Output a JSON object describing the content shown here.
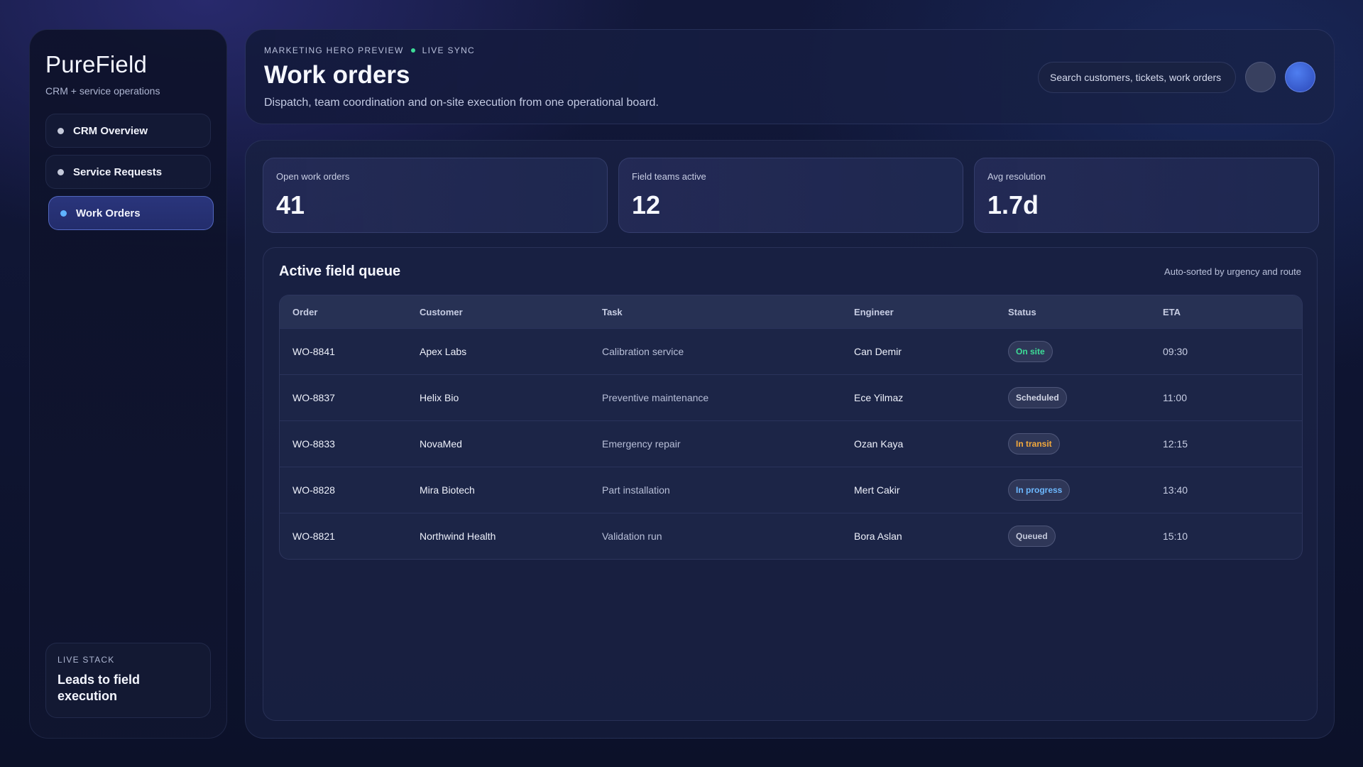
{
  "sidebar": {
    "brand": "PureField",
    "brand_sub": "CRM + service operations",
    "items": [
      {
        "label": "CRM Overview",
        "active": false
      },
      {
        "label": "Service Requests",
        "active": false
      },
      {
        "label": "Work Orders",
        "active": true
      }
    ],
    "live_stack": {
      "eyebrow": "LIVE STACK",
      "title": "Leads to field execution"
    }
  },
  "header": {
    "eyebrow": "MARKETING HERO PREVIEW",
    "eyebrow_status": "LIVE SYNC",
    "title": "Work orders",
    "description": "Dispatch, team coordination and on-site execution from one operational board.",
    "search_placeholder": "Search customers, tickets, work orders"
  },
  "stats": [
    {
      "label": "Open work orders",
      "value": "41"
    },
    {
      "label": "Field teams active",
      "value": "12"
    },
    {
      "label": "Avg resolution",
      "value": "1.7d"
    }
  ],
  "queue": {
    "title": "Active field queue",
    "note": "Auto-sorted by urgency and route",
    "columns": [
      "Order",
      "Customer",
      "Task",
      "Engineer",
      "Status",
      "ETA"
    ],
    "rows": [
      {
        "order": "WO-8841",
        "customer": "Apex Labs",
        "task": "Calibration service",
        "engineer": "Can Demir",
        "status": "On site",
        "eta": "09:30"
      },
      {
        "order": "WO-8837",
        "customer": "Helix Bio",
        "task": "Preventive maintenance",
        "engineer": "Ece Yilmaz",
        "status": "Scheduled",
        "eta": "11:00"
      },
      {
        "order": "WO-8833",
        "customer": "NovaMed",
        "task": "Emergency repair",
        "engineer": "Ozan Kaya",
        "status": "In transit",
        "eta": "12:15"
      },
      {
        "order": "WO-8828",
        "customer": "Mira Biotech",
        "task": "Part installation",
        "engineer": "Mert Cakir",
        "status": "In progress",
        "eta": "13:40"
      },
      {
        "order": "WO-8821",
        "customer": "Northwind Health",
        "task": "Validation run",
        "engineer": "Bora Aslan",
        "status": "Queued",
        "eta": "15:10"
      }
    ]
  },
  "colors": {
    "accent": "#5fb3ff",
    "live": "#3ddc97",
    "status_on_site": "#3ddc97",
    "status_scheduled": "#d3d7e6",
    "status_in_transit": "#f3a93c",
    "status_in_progress": "#6cb8ff",
    "status_queued": "#c4c9da"
  }
}
